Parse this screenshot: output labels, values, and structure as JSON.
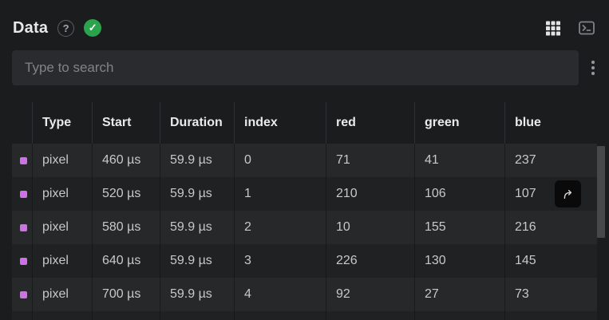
{
  "header": {
    "title": "Data",
    "help_glyph": "?",
    "status_ok_glyph": "✓"
  },
  "toolbar": {
    "icons": [
      "table-grid-icon",
      "terminal-icon"
    ]
  },
  "search": {
    "placeholder": "Type to search",
    "value": "",
    "overflow_menu_icon": "kebab-menu"
  },
  "colors": {
    "swatch_purple": "#cf70e8",
    "status_ok_green": "#2ba24c"
  },
  "table": {
    "columns": [
      {
        "key": "icon",
        "label": ""
      },
      {
        "key": "type",
        "label": "Type"
      },
      {
        "key": "start",
        "label": "Start"
      },
      {
        "key": "duration",
        "label": "Duration"
      },
      {
        "key": "index",
        "label": "index"
      },
      {
        "key": "red",
        "label": "red"
      },
      {
        "key": "green",
        "label": "green"
      },
      {
        "key": "blue",
        "label": "blue"
      }
    ],
    "fields": [
      "type",
      "start",
      "duration",
      "index",
      "red",
      "green",
      "blue"
    ],
    "rows": [
      {
        "type": "pixel",
        "start": "460 µs",
        "duration": "59.9 µs",
        "index": "0",
        "red": "71",
        "green": "41",
        "blue": "237"
      },
      {
        "type": "pixel",
        "start": "520 µs",
        "duration": "59.9 µs",
        "index": "1",
        "red": "210",
        "green": "106",
        "blue": "107"
      },
      {
        "type": "pixel",
        "start": "580 µs",
        "duration": "59.9 µs",
        "index": "2",
        "red": "10",
        "green": "155",
        "blue": "216"
      },
      {
        "type": "pixel",
        "start": "640 µs",
        "duration": "59.9 µs",
        "index": "3",
        "red": "226",
        "green": "130",
        "blue": "145"
      },
      {
        "type": "pixel",
        "start": "700 µs",
        "duration": "59.9 µs",
        "index": "4",
        "red": "92",
        "green": "27",
        "blue": "73"
      }
    ],
    "row_action": {
      "row_index": 1,
      "icon": "goto-arrow"
    }
  }
}
